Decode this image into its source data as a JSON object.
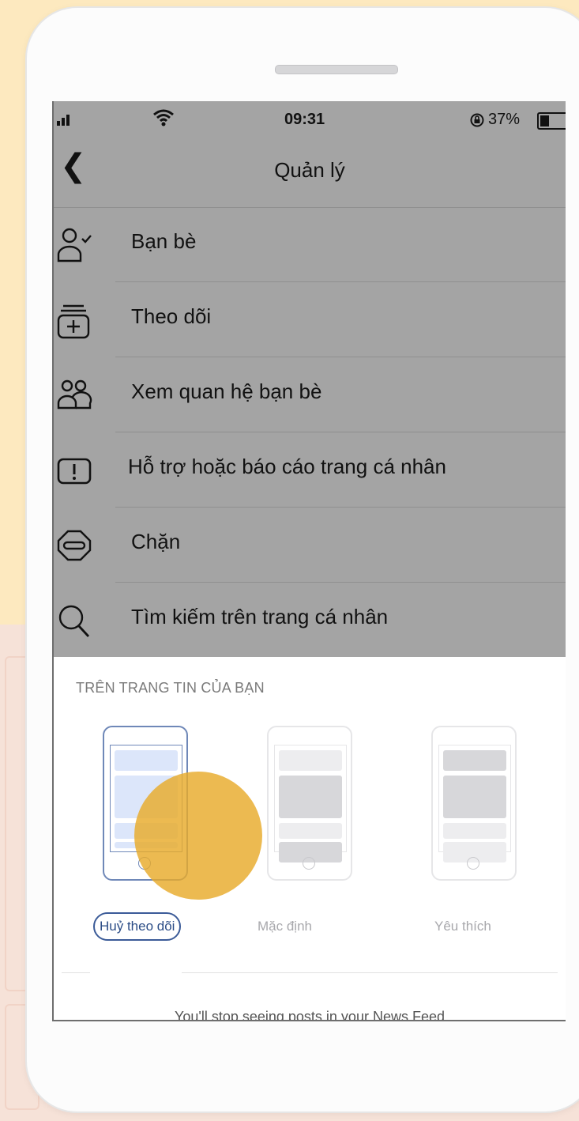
{
  "status_bar": {
    "time": "09:31",
    "battery": "37%"
  },
  "header": {
    "title": "Quản lý"
  },
  "menu": [
    {
      "label": "Bạn bè",
      "icon": "friend-check-icon"
    },
    {
      "label": "Theo dõi",
      "icon": "follow-stack-icon"
    },
    {
      "label": "Xem quan hệ bạn bè",
      "icon": "people-icon"
    },
    {
      "label": "Hỗ trợ hoặc báo cáo trang cá nhân",
      "icon": "report-icon"
    },
    {
      "label": "Chặn",
      "icon": "block-icon"
    },
    {
      "label": "Tìm kiếm trên trang cá nhân",
      "icon": "search-icon"
    }
  ],
  "news_feed": {
    "section_title": "TRÊN TRANG TIN CỦA BẠN",
    "options": [
      {
        "label": "Huỷ theo dõi",
        "selected": true
      },
      {
        "label": "Mặc định",
        "selected": false
      },
      {
        "label": "Yêu thích",
        "selected": false
      }
    ],
    "footer_text": "You'll stop seeing posts in your News Feed"
  },
  "colors": {
    "overlay": "#a4a4a4",
    "accent": "#3b5b98",
    "touch": "#e8ab2b",
    "background": "#fde9bf"
  }
}
